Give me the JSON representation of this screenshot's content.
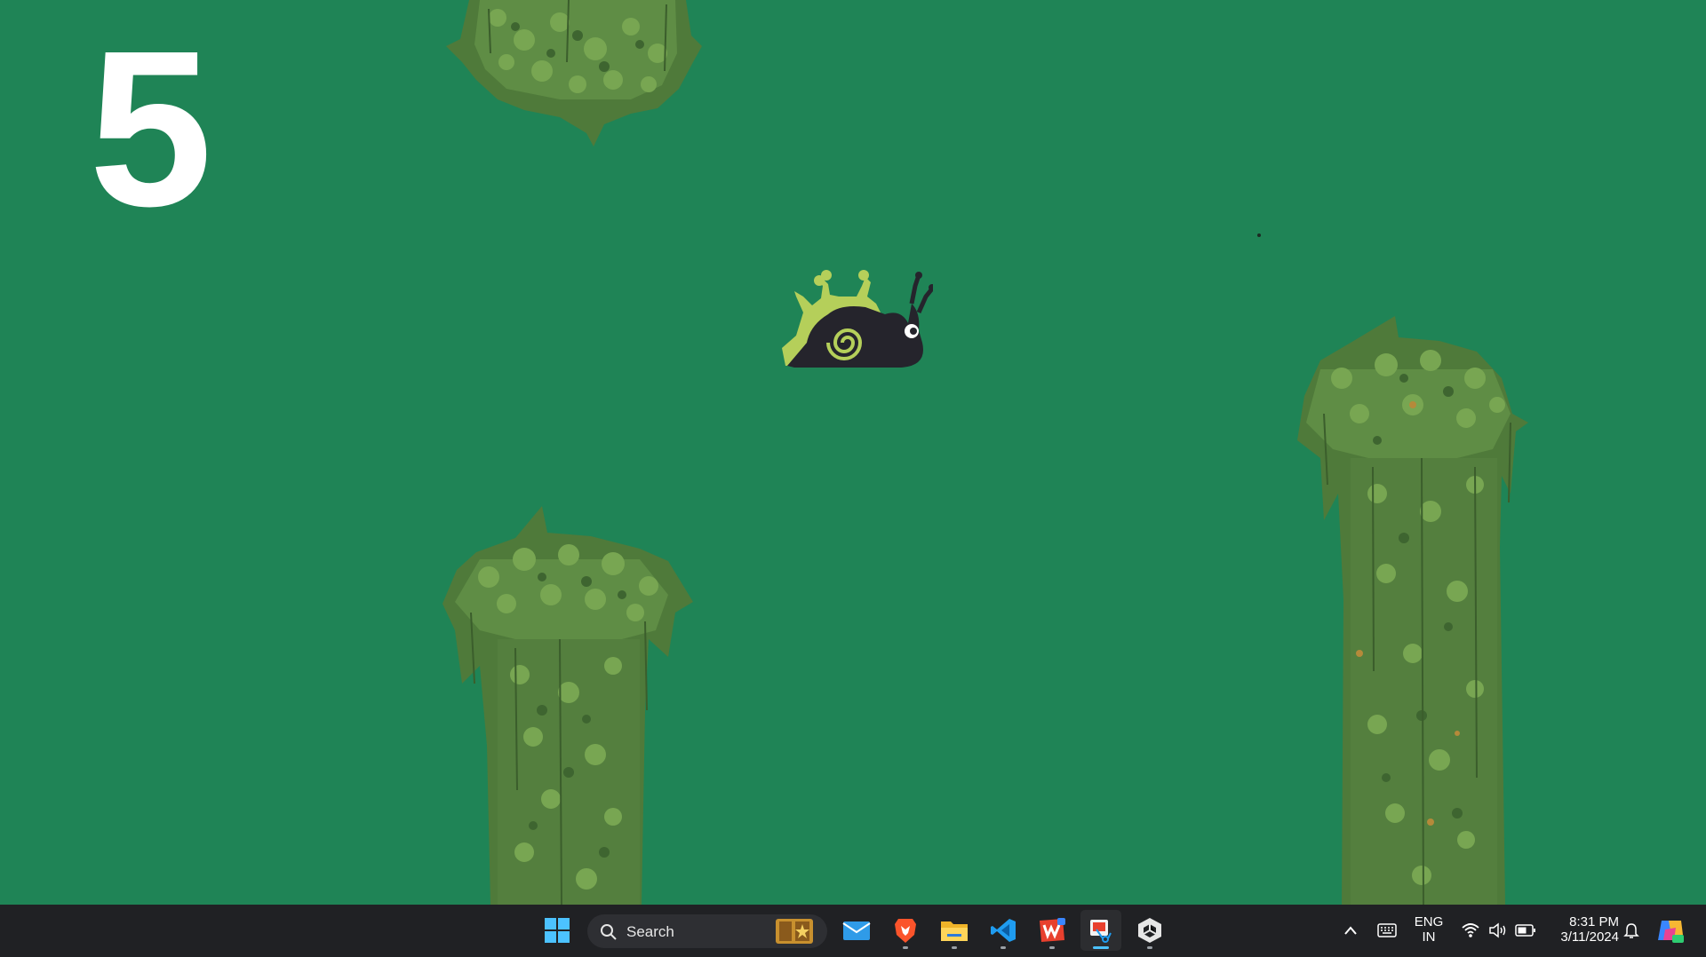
{
  "game": {
    "score": "5",
    "background_color": "#1f8456",
    "player": {
      "character": "snail",
      "shell_color": "#b5cf5a",
      "body_color": "#25242c"
    },
    "obstacles": [
      "top-pillar",
      "bottom-pillar-left",
      "bottom-pillar-right"
    ]
  },
  "taskbar": {
    "search_placeholder": "Search",
    "apps": [
      "start-icon",
      "mail-icon",
      "brave-icon",
      "file-explorer-icon",
      "vscode-icon",
      "wps-office-icon",
      "snipping-tool-icon",
      "unity-icon"
    ],
    "language_line1": "ENG",
    "language_line2": "IN",
    "time": "8:31 PM",
    "date": "3/11/2024"
  }
}
